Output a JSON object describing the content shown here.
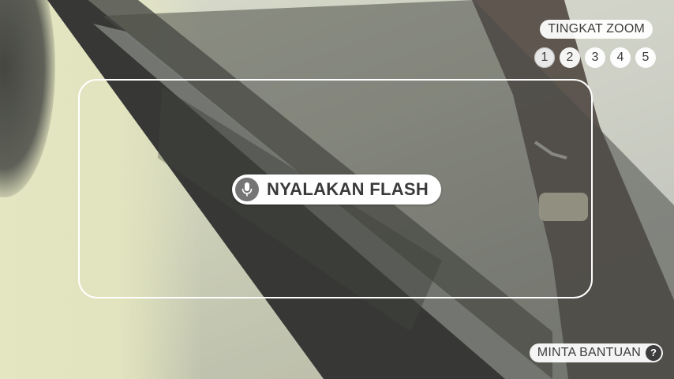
{
  "camera": {
    "scene_icon": "camera-preview"
  },
  "zoom": {
    "label": "TINGKAT ZOOM",
    "levels": [
      "1",
      "2",
      "3",
      "4",
      "5"
    ],
    "selected": "1"
  },
  "voice_command": {
    "icon": "mic-icon",
    "label": "NYALAKAN FLASH"
  },
  "help": {
    "label": "MINTA BANTUAN",
    "icon_glyph": "?"
  },
  "colors": {
    "pill_background": "#ffffff",
    "pill_text": "#3c3c3c",
    "mic_background": "#757575",
    "frame_border": "#ffffff"
  }
}
